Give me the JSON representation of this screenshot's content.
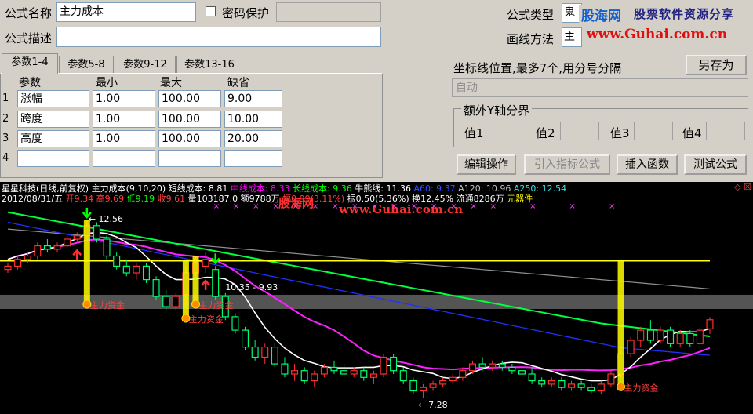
{
  "form": {
    "name_label": "公式名称",
    "name_value": "主力成本",
    "password_label": "密码保护",
    "desc_label": "公式描述",
    "desc_value": "",
    "type_label": "公式类型",
    "type_value": "鬼",
    "draw_label": "画线方法",
    "draw_value": "主",
    "save_as": "另存为",
    "axis_label": "坐标线位置,最多7个,用分号分隔",
    "axis_value": "自动",
    "yaxis_group": "额外Y轴分界",
    "v1": "值1",
    "v2": "值2",
    "v3": "值3",
    "v4": "值4",
    "btn_edit": "编辑操作",
    "btn_import": "引入指标公式",
    "btn_insert": "插入函数",
    "btn_test": "测试公式"
  },
  "tabs": [
    "参数1-4",
    "参数5-8",
    "参数9-12",
    "参数13-16"
  ],
  "params": {
    "headers": [
      "参数",
      "最小",
      "最大",
      "缺省"
    ],
    "rows": [
      {
        "n": "1",
        "name": "涨幅",
        "min": "1.00",
        "max": "100.00",
        "def": "9.00"
      },
      {
        "n": "2",
        "name": "跨度",
        "min": "1.00",
        "max": "100.00",
        "def": "10.00"
      },
      {
        "n": "3",
        "name": "高度",
        "min": "1.00",
        "max": "100.00",
        "def": "20.00"
      },
      {
        "n": "4",
        "name": "",
        "min": "",
        "max": "",
        "def": ""
      }
    ]
  },
  "watermark": {
    "logo": "股海网",
    "slogan": "股票软件资源分享",
    "url": "www.Guhai.com.cn"
  },
  "chart_info": {
    "line1": [
      {
        "t": "星星科技(日线,前复权) 主力成本(9,10,20)",
        "c": "#ffffff"
      },
      {
        "t": "短线成本: 8.81",
        "c": "#ffffff"
      },
      {
        "t": "中线成本: 8.33",
        "c": "#ff00ff"
      },
      {
        "t": "长线成本: 9.36",
        "c": "#00ff00"
      },
      {
        "t": "牛熊线: 11.36",
        "c": "#ffffff"
      },
      {
        "t": "A60: 9.37",
        "c": "#3050ff"
      },
      {
        "t": "A120: 10.96",
        "c": "#c0c0c0"
      },
      {
        "t": "A250: 12.54",
        "c": "#40e0e0"
      }
    ],
    "line2": [
      {
        "t": "2012/08/31/五",
        "c": "#ffffff"
      },
      {
        "t": "开9.34",
        "c": "#ff4040"
      },
      {
        "t": "高9.69",
        "c": "#ff4040"
      },
      {
        "t": "低9.19",
        "c": "#00ff00"
      },
      {
        "t": "收9.61",
        "c": "#ff4040"
      },
      {
        "t": "量103187.0",
        "c": "#ffffff"
      },
      {
        "t": "额9788万",
        "c": "#ffffff"
      },
      {
        "t": "幅0.99(3.11%)",
        "c": "#ff4040"
      },
      {
        "t": "振0.50(5.36%)",
        "c": "#ffffff"
      },
      {
        "t": "换12.45%",
        "c": "#ffffff"
      },
      {
        "t": "流通8286万",
        "c": "#ffffff"
      },
      {
        "t": "元器件",
        "c": "#ffff00"
      }
    ],
    "hi_label": "12.56",
    "range_label": "10.35 - 9.93",
    "lo_label": "7.28",
    "signal_label": "主力资金"
  },
  "chart_data": {
    "type": "candlestick",
    "title": "星星科技(日线,前复权) 主力成本(9,10,20)",
    "candles": [
      [
        11.1,
        11.3,
        11.0,
        11.2
      ],
      [
        11.2,
        11.5,
        11.1,
        11.4
      ],
      [
        11.4,
        11.6,
        11.3,
        11.5
      ],
      [
        11.5,
        11.9,
        11.4,
        11.8
      ],
      [
        11.8,
        12.0,
        11.6,
        11.7
      ],
      [
        11.7,
        11.9,
        11.6,
        11.8
      ],
      [
        11.8,
        12.1,
        11.7,
        12.0
      ],
      [
        12.0,
        12.2,
        11.9,
        12.1
      ],
      [
        12.1,
        12.56,
        12.0,
        12.4
      ],
      [
        12.4,
        12.5,
        11.9,
        12.0
      ],
      [
        12.0,
        12.1,
        11.4,
        11.5
      ],
      [
        11.5,
        11.6,
        11.1,
        11.2
      ],
      [
        11.2,
        11.4,
        10.9,
        11.0
      ],
      [
        11.0,
        11.3,
        10.8,
        11.2
      ],
      [
        11.2,
        11.3,
        10.7,
        10.8
      ],
      [
        10.8,
        10.9,
        10.2,
        10.3
      ],
      [
        10.3,
        10.5,
        9.9,
        10.0
      ],
      [
        10.0,
        10.4,
        9.9,
        10.3
      ],
      [
        10.35,
        11.2,
        9.93,
        11.0
      ],
      [
        11.0,
        11.5,
        10.8,
        11.3
      ],
      [
        11.2,
        11.6,
        11.0,
        11.4
      ],
      [
        11.1,
        11.2,
        10.2,
        10.3
      ],
      [
        10.3,
        10.4,
        9.6,
        9.7
      ],
      [
        9.7,
        9.8,
        9.2,
        9.3
      ],
      [
        9.3,
        9.4,
        8.7,
        8.8
      ],
      [
        8.8,
        9.0,
        8.4,
        8.5
      ],
      [
        8.5,
        8.9,
        8.3,
        8.8
      ],
      [
        8.8,
        8.9,
        8.2,
        8.3
      ],
      [
        8.3,
        8.5,
        7.9,
        8.0
      ],
      [
        8.0,
        8.3,
        7.8,
        8.1
      ],
      [
        8.1,
        8.2,
        7.7,
        7.8
      ],
      [
        7.8,
        8.1,
        7.6,
        8.0
      ],
      [
        8.0,
        8.3,
        7.9,
        8.2
      ],
      [
        8.2,
        8.4,
        8.0,
        8.1
      ],
      [
        8.1,
        8.3,
        7.9,
        8.0
      ],
      [
        8.0,
        8.2,
        7.9,
        8.1
      ],
      [
        8.1,
        8.2,
        7.8,
        7.9
      ],
      [
        7.9,
        8.1,
        7.7,
        8.0
      ],
      [
        8.0,
        8.6,
        7.9,
        8.5
      ],
      [
        8.5,
        8.6,
        8.0,
        8.1
      ],
      [
        8.1,
        8.2,
        7.7,
        7.8
      ],
      [
        7.8,
        7.9,
        7.4,
        7.5
      ],
      [
        7.5,
        7.7,
        7.28,
        7.6
      ],
      [
        7.6,
        7.8,
        7.5,
        7.7
      ],
      [
        7.7,
        7.9,
        7.6,
        7.8
      ],
      [
        7.8,
        8.0,
        7.7,
        7.9
      ],
      [
        7.9,
        8.2,
        7.8,
        8.1
      ],
      [
        8.1,
        8.4,
        8.0,
        8.3
      ],
      [
        8.3,
        8.5,
        8.1,
        8.2
      ],
      [
        8.2,
        8.4,
        8.1,
        8.3
      ],
      [
        8.3,
        8.4,
        8.1,
        8.2
      ],
      [
        8.2,
        8.3,
        8.0,
        8.1
      ],
      [
        8.1,
        8.2,
        7.9,
        8.0
      ],
      [
        8.0,
        8.2,
        7.7,
        7.8
      ],
      [
        7.8,
        7.9,
        7.6,
        7.7
      ],
      [
        7.7,
        7.9,
        7.6,
        7.8
      ],
      [
        7.8,
        7.9,
        7.5,
        7.6
      ],
      [
        7.6,
        7.8,
        7.5,
        7.7
      ],
      [
        7.7,
        7.8,
        7.5,
        7.6
      ],
      [
        7.6,
        7.7,
        7.4,
        7.5
      ],
      [
        7.5,
        7.8,
        7.4,
        7.7
      ],
      [
        7.7,
        8.1,
        7.6,
        8.0
      ],
      [
        8.0,
        8.7,
        7.9,
        8.6
      ],
      [
        8.6,
        9.1,
        8.5,
        9.0
      ],
      [
        9.0,
        9.4,
        8.8,
        9.3
      ],
      [
        9.3,
        9.6,
        8.9,
        9.0
      ],
      [
        9.0,
        9.4,
        8.9,
        9.3
      ],
      [
        9.3,
        9.4,
        8.8,
        8.9
      ],
      [
        8.9,
        9.3,
        8.8,
        9.2
      ],
      [
        9.2,
        9.3,
        8.8,
        8.9
      ],
      [
        8.9,
        9.4,
        8.8,
        9.3
      ],
      [
        9.34,
        9.69,
        9.19,
        9.61
      ]
    ],
    "signals": [
      8,
      18,
      19,
      62
    ],
    "xmarks": [
      21,
      23,
      25,
      27,
      29,
      31,
      33,
      35,
      37,
      39,
      41,
      43,
      45,
      47,
      49,
      53,
      57,
      61
    ],
    "series": [
      {
        "name": "短线成本",
        "color": "#ffffff",
        "last": 8.81
      },
      {
        "name": "中线成本",
        "color": "#ff00ff",
        "last": 8.33
      },
      {
        "name": "长线成本",
        "color": "#00ff00",
        "last": 9.36
      },
      {
        "name": "A60",
        "color": "#2040ff",
        "last": 9.37
      },
      {
        "name": "A120",
        "color": "#a0a0a0",
        "last": 10.96
      }
    ],
    "bull_bear_line": 11.36,
    "band": [
      10.35,
      9.93
    ],
    "ylim": [
      7.0,
      13.0
    ]
  }
}
